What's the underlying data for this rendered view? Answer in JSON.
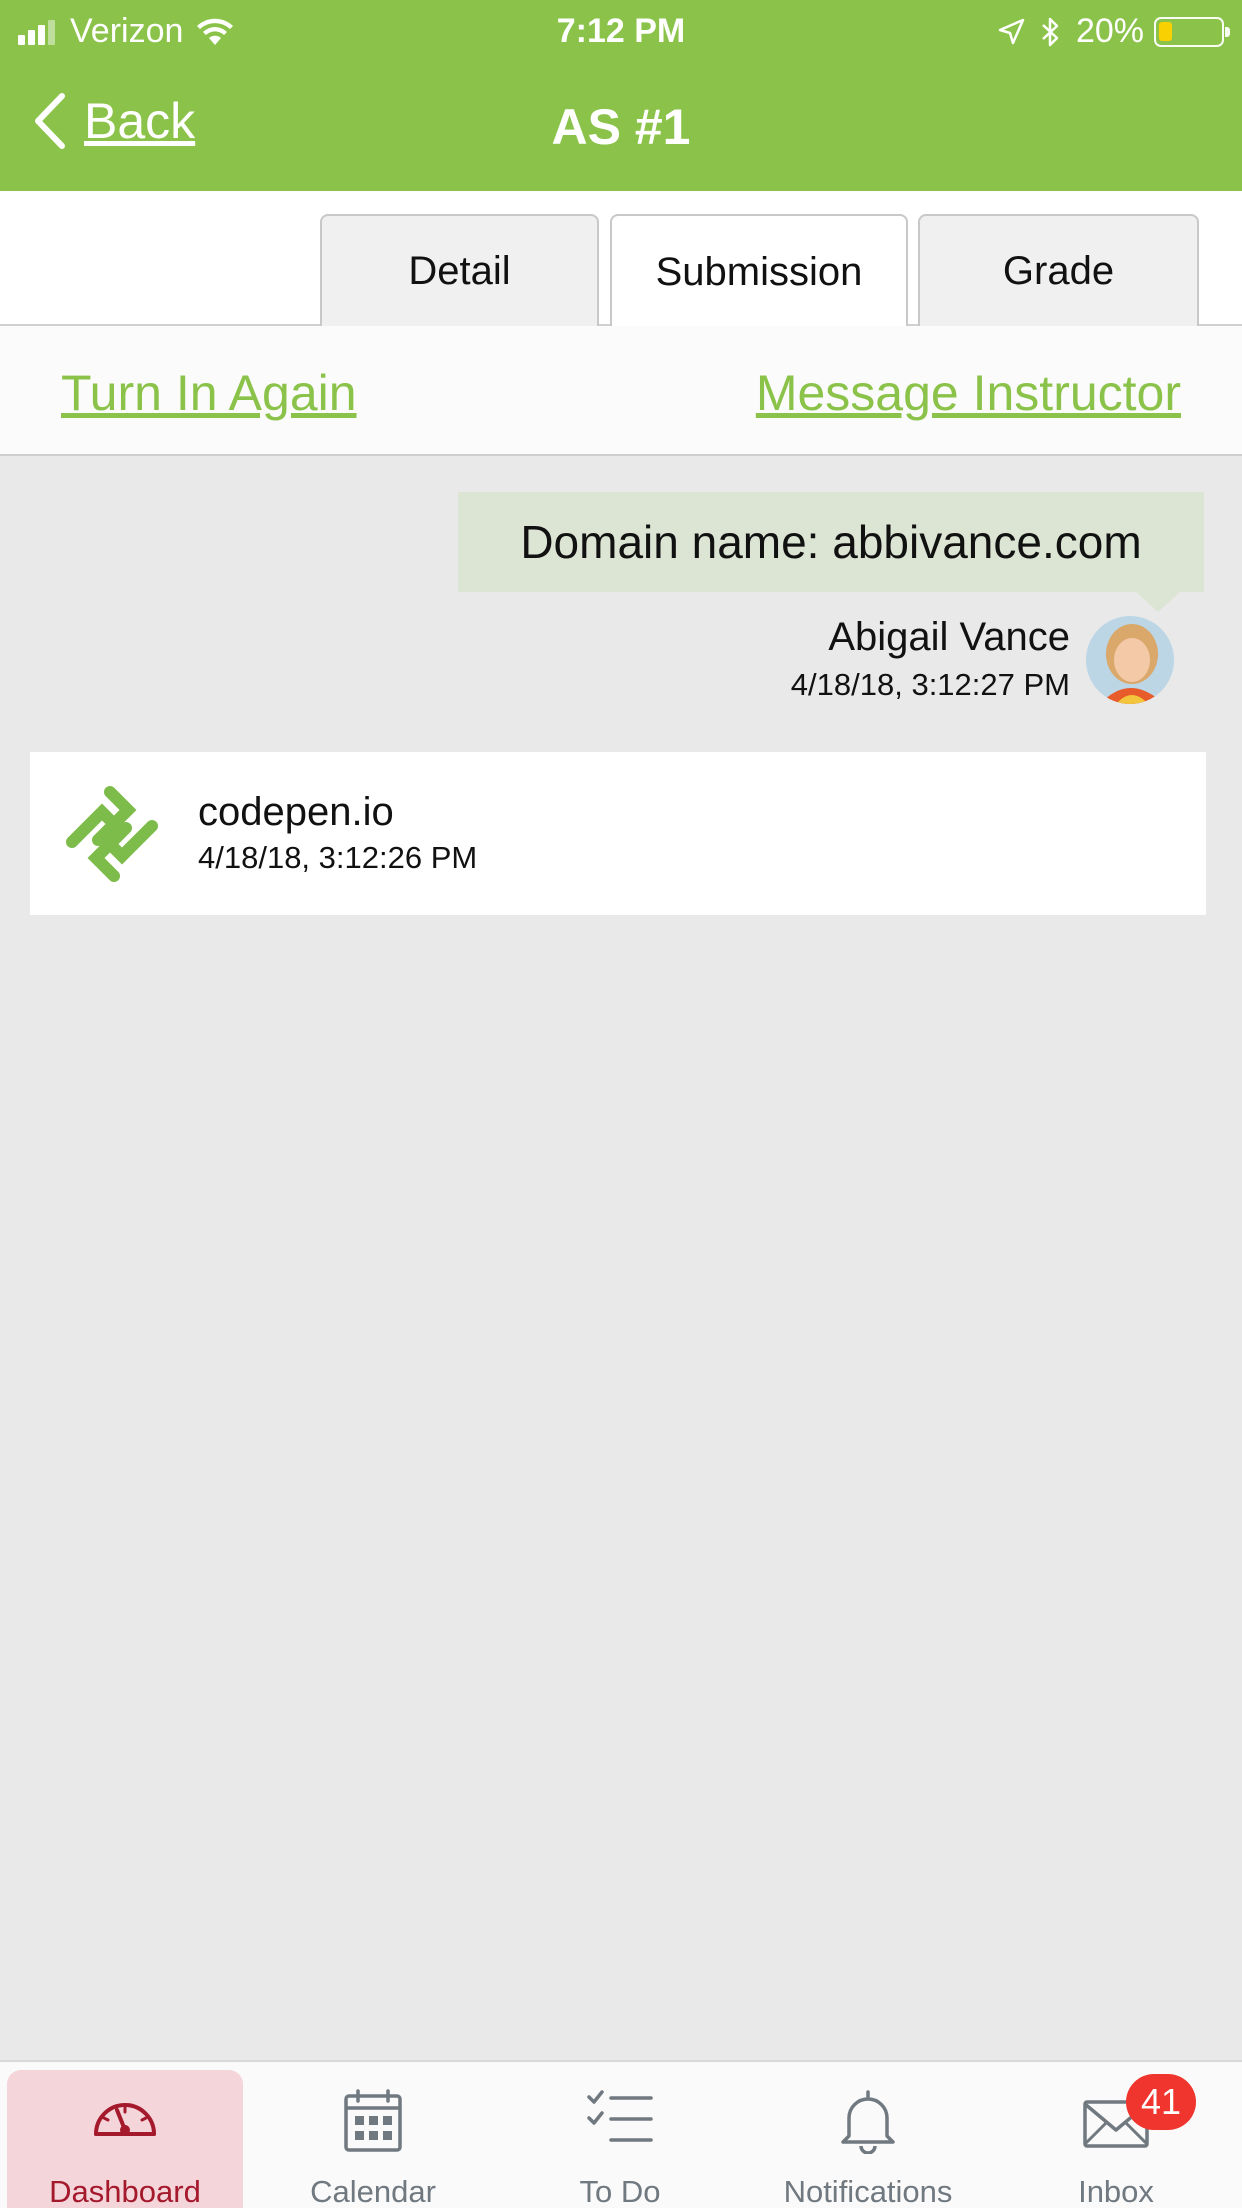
{
  "status_bar": {
    "carrier": "Verizon",
    "time": "7:12 PM",
    "battery": "20%",
    "battery_level": 0.2
  },
  "nav": {
    "back_label": "Back",
    "title": "AS #1"
  },
  "tabs": [
    {
      "label": "Detail"
    },
    {
      "label": "Submission"
    },
    {
      "label": "Grade"
    }
  ],
  "active_tab": "Submission",
  "actions": {
    "turn_in_again": "Turn In Again",
    "message_instructor": "Message Instructor"
  },
  "submission": {
    "message": "Domain name: abbivance.com",
    "author": "Abigail Vance",
    "timestamp": "4/18/18, 3:12:27 PM"
  },
  "link": {
    "title": "codepen.io",
    "timestamp": "4/18/18, 3:12:26 PM",
    "icon": "codepen-logo-icon"
  },
  "tabbar": {
    "items": [
      {
        "label": "Dashboard",
        "icon": "gauge-icon"
      },
      {
        "label": "Calendar",
        "icon": "calendar-icon"
      },
      {
        "label": "To Do",
        "icon": "checklist-icon"
      },
      {
        "label": "Notifications",
        "icon": "bell-icon"
      },
      {
        "label": "Inbox",
        "icon": "envelope-icon"
      }
    ],
    "inbox_badge": "41",
    "active": "Dashboard"
  },
  "colors": {
    "brand_green": "#8bc34a",
    "active_tab_bg": "#f3d5da",
    "active_tab_fg": "#a4192c",
    "badge_red": "#f0352e",
    "bubble_bg": "#dce5d3"
  }
}
